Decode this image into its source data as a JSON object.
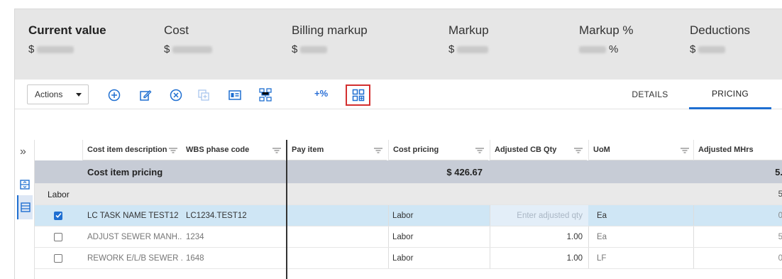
{
  "summary": {
    "current_value_label": "Current value",
    "cost_label": "Cost",
    "billing_markup_label": "Billing markup",
    "markup_label": "Markup",
    "markup_pct_label": "Markup %",
    "deductions_label": "Deductions",
    "currency": "$",
    "percent": "%"
  },
  "toolbar": {
    "actions_label": "Actions",
    "percent_button": "+%",
    "tabs": [
      "DETAILS",
      "PRICING"
    ],
    "active_tab": "PRICING"
  },
  "grid": {
    "columns": [
      "Cost item description",
      "WBS phase code",
      "Pay item",
      "Cost pricing",
      "Adjusted CB Qty",
      "UoM",
      "Adjusted MHrs"
    ],
    "group_row": {
      "label": "Cost item pricing",
      "cost_pricing": "$ 426.67",
      "adjusted_mhrs": "5."
    },
    "subgroup_row": {
      "label": "Labor",
      "adjusted_mhrs": "5"
    },
    "rows": [
      {
        "checked": true,
        "description": "LC TASK NAME TEST12",
        "wbs": "LC1234.TEST12",
        "pay_item": "",
        "cost_pricing": "Labor",
        "adj_qty": "",
        "adj_qty_placeholder": "Enter adjusted qty",
        "uom": "Ea",
        "mhrs": "0"
      },
      {
        "checked": false,
        "description": "ADJUST SEWER MANH...",
        "wbs": "1234",
        "pay_item": "",
        "cost_pricing": "Labor",
        "adj_qty": "1.00",
        "adj_qty_placeholder": "",
        "uom": "Ea",
        "mhrs": "5"
      },
      {
        "checked": false,
        "description": "REWORK E/L/B SEWER ...",
        "wbs": "1648",
        "pay_item": "",
        "cost_pricing": "Labor",
        "adj_qty": "1.00",
        "adj_qty_placeholder": "",
        "uom": "LF",
        "mhrs": "0"
      }
    ]
  },
  "colors": {
    "accent": "#1f6fd1",
    "highlight_box": "#d32f2f",
    "selected_row": "#cfe6f5",
    "group_row": "#c7ccd6",
    "summary_bg": "#e6e6e6"
  },
  "icons": [
    "add-circle-icon",
    "edit-icon",
    "remove-circle-icon",
    "copy-icon",
    "card-view-icon",
    "hierarchy-icon",
    "grid-add-icon",
    "double-chevron-right-icon",
    "expand-rows-icon",
    "list-view-icon",
    "filter-icon",
    "checkbox-icon"
  ]
}
